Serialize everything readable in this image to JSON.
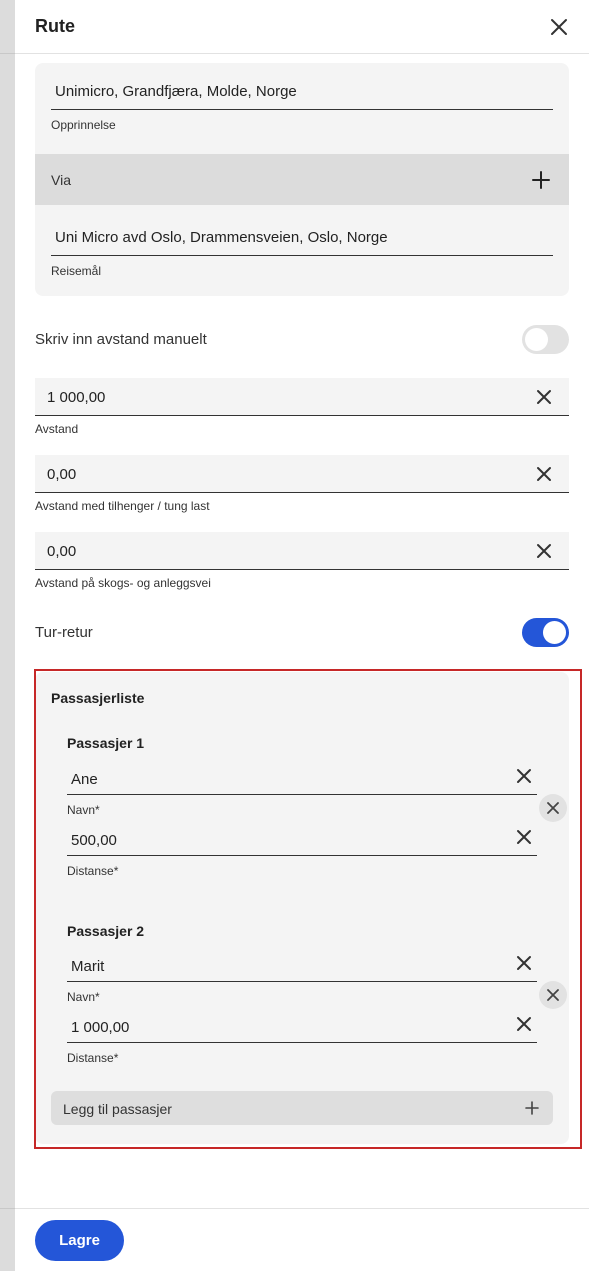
{
  "header": {
    "title": "Rute"
  },
  "route": {
    "origin": {
      "value": "Unimicro, Grandfjæra, Molde, Norge",
      "label": "Opprinnelse"
    },
    "via": {
      "label": "Via"
    },
    "destination": {
      "value": "Uni Micro avd Oslo, Drammensveien, Oslo, Norge",
      "label": "Reisemål"
    }
  },
  "manual_distance": {
    "label": "Skriv inn avstand manuelt",
    "enabled": false
  },
  "distances": [
    {
      "value": "1 000,00",
      "label": "Avstand"
    },
    {
      "value": "0,00",
      "label": "Avstand med tilhenger / tung last"
    },
    {
      "value": "0,00",
      "label": "Avstand på skogs- og anleggsvei"
    }
  ],
  "round_trip": {
    "label": "Tur-retur",
    "enabled": true
  },
  "passengers": {
    "title": "Passasjerliste",
    "items": [
      {
        "heading": "Passasjer 1",
        "name": "Ane",
        "name_label": "Navn*",
        "distance": "500,00",
        "distance_label": "Distanse*"
      },
      {
        "heading": "Passasjer 2",
        "name": "Marit",
        "name_label": "Navn*",
        "distance": "1 000,00",
        "distance_label": "Distanse*"
      }
    ],
    "add_label": "Legg til passasjer"
  },
  "footer": {
    "save_label": "Lagre"
  },
  "colors": {
    "accent": "#2456d8",
    "highlight": "#c62828",
    "field_bg": "#f4f4f4"
  }
}
